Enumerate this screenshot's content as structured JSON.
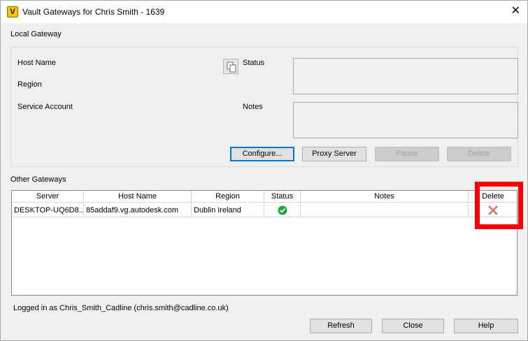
{
  "window": {
    "title": "Vault Gateways for Chris Smith - 1639",
    "icon": "vault-app-icon",
    "icon_letter": "V",
    "close": "✕"
  },
  "local_gateway": {
    "section_label": "Local Gateway",
    "host_name_label": "Host Name",
    "region_label": "Region",
    "service_account_label": "Service Account",
    "status_label": "Status",
    "notes_label": "Notes",
    "copy_icon": "copy-icon",
    "buttons": {
      "configure": "Configure...",
      "proxy_server": "Proxy Server",
      "pause": "Pause",
      "delete": "Delete"
    }
  },
  "other_gateways": {
    "section_label": "Other Gateways",
    "columns": [
      "Server",
      "Host Name",
      "Region",
      "Status",
      "Notes",
      "Delete"
    ],
    "rows": [
      {
        "server": "DESKTOP-UQ6D8...",
        "host_name": "85addaf9.vg.autodesk.com",
        "region": "Dublin Ireland",
        "status_icon": "check-circle-icon",
        "notes": "",
        "delete_icon": "delete-x-icon"
      }
    ]
  },
  "footer": {
    "logged_in_text": "Logged in as Chris_Smith_Cadline (chris.smith@cadline.co.uk)",
    "buttons": {
      "refresh": "Refresh",
      "close": "Close",
      "help": "Help"
    }
  },
  "colors": {
    "status_ok": "#1fa33a",
    "delete_x": "#d9534f",
    "annotation": "#ff0000",
    "default_button_border": "#0078d7"
  }
}
